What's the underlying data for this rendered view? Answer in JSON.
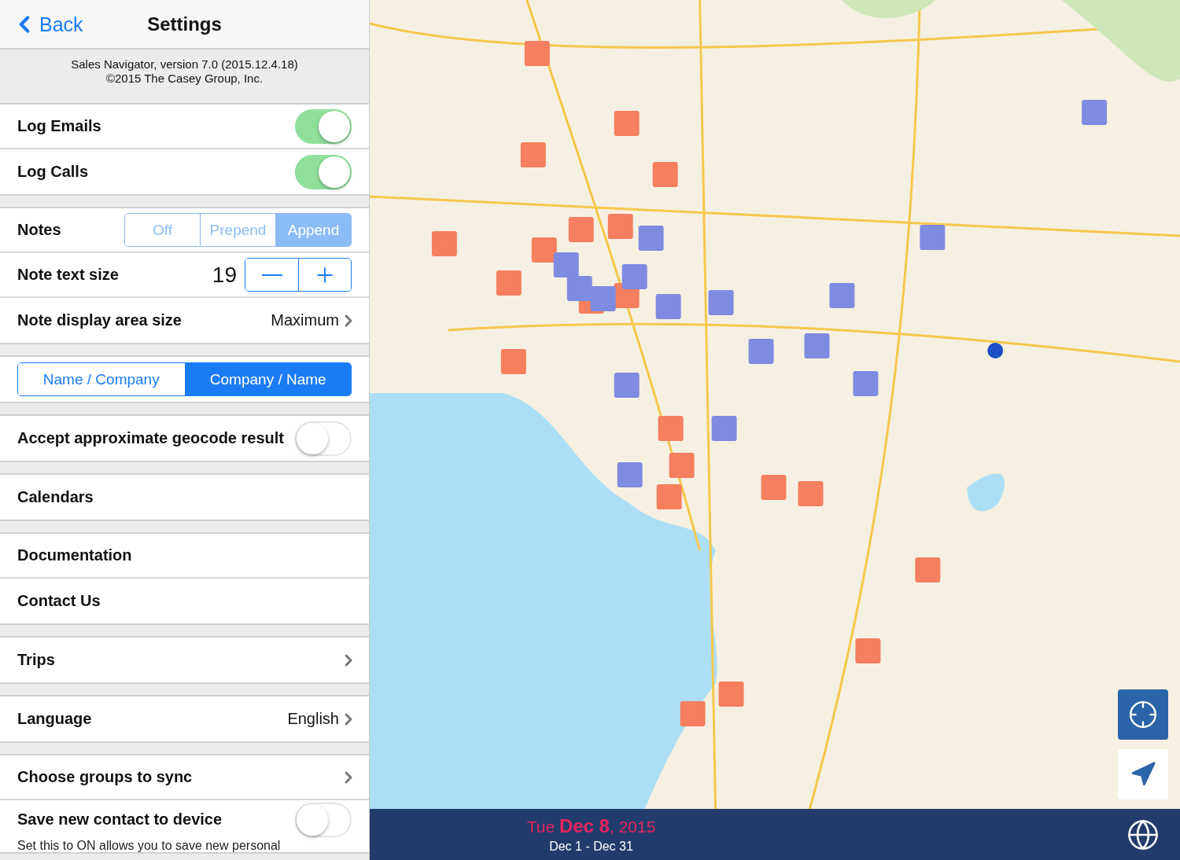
{
  "nav": {
    "back": "Back",
    "title": "Settings"
  },
  "about": [
    "Sales Navigator, version 7.0 (2015.12.4.18)",
    "©2015 The Casey Group, Inc."
  ],
  "sections": [
    {
      "items": [
        {
          "kind": "toggle",
          "label": "Log Emails",
          "on": true
        },
        {
          "kind": "toggle",
          "label": "Log Calls",
          "on": true
        }
      ]
    },
    {
      "items": [
        {
          "kind": "segmented",
          "label": "Notes",
          "options": [
            {
              "label": "Off",
              "selected": false
            },
            {
              "label": "Prepend",
              "selected": false
            },
            {
              "label": "Append",
              "selected": true
            }
          ]
        },
        {
          "kind": "stepper",
          "label": "Note text size",
          "value": "19"
        },
        {
          "kind": "link",
          "label": "Note display area size",
          "value": "Maximum",
          "chevron": true
        }
      ]
    },
    {
      "items": [
        {
          "kind": "order",
          "options": [
            {
              "label": "Name / Company",
              "selected": false
            },
            {
              "label": "Company / Name",
              "selected": true
            }
          ]
        }
      ]
    },
    {
      "items": [
        {
          "kind": "toggle",
          "label": "Accept approximate geocode result",
          "on": false
        }
      ]
    },
    {
      "items": [
        {
          "kind": "link",
          "label": "Calendars",
          "chevron": false
        }
      ]
    },
    {
      "items": [
        {
          "kind": "link",
          "label": "Documentation",
          "chevron": false
        },
        {
          "kind": "link",
          "label": "Contact Us",
          "chevron": false
        }
      ]
    },
    {
      "items": [
        {
          "kind": "link",
          "label": "Trips",
          "chevron": true
        }
      ]
    },
    {
      "items": [
        {
          "kind": "link",
          "label": "Language",
          "value": "English",
          "chevron": true
        }
      ]
    },
    {
      "items": [
        {
          "kind": "link",
          "label": "Choose groups to sync",
          "chevron": true
        },
        {
          "kind": "toggle",
          "label": "Save new contact to device",
          "on": false,
          "note": "Set this to ON allows you to save new personal"
        }
      ]
    }
  ],
  "map": {
    "date": "Tue **Dec 8**, 2015",
    "range": "Dec 1 - Dec 31"
  }
}
